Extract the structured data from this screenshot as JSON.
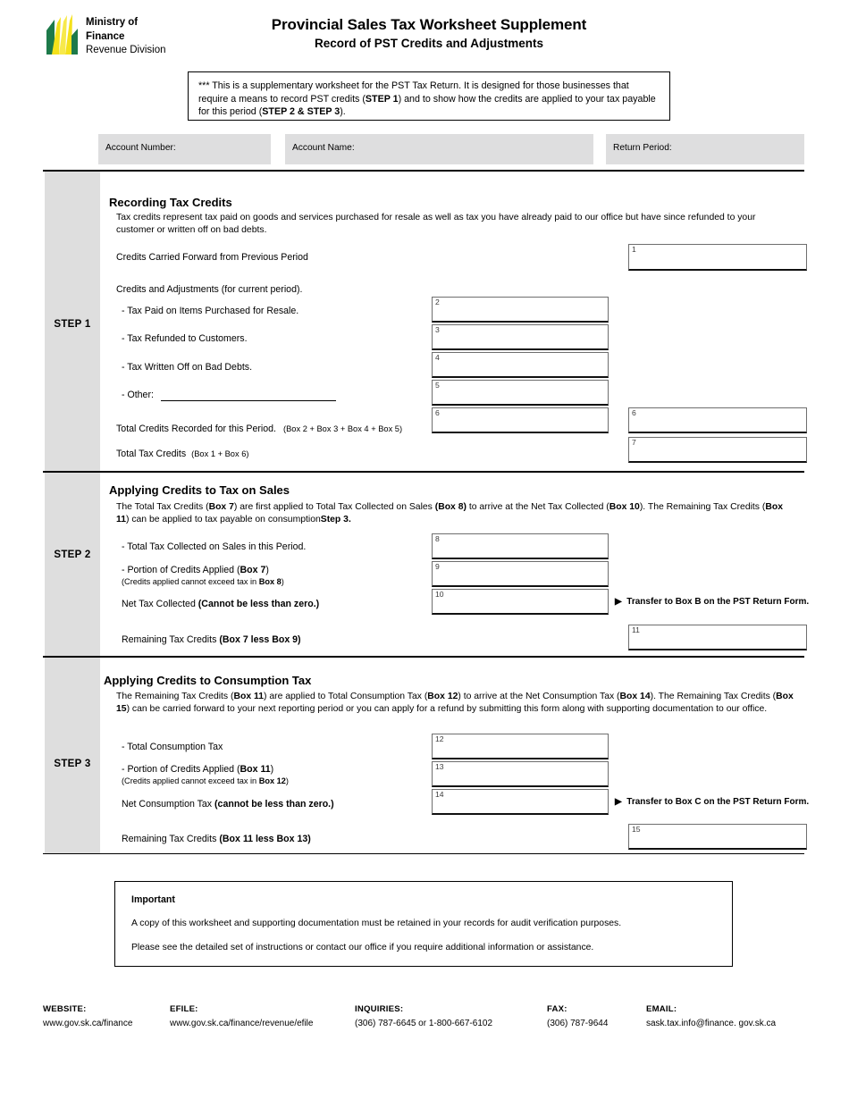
{
  "header": {
    "ministry_line1": "Ministry of",
    "ministry_line2": "Finance",
    "ministry_line3": "Revenue Division",
    "title": "Provincial Sales Tax Worksheet Supplement",
    "subtitle": "Record of PST Credits and Adjustments",
    "logo_icon": "saskatchewan-wheat-sheaf-logo"
  },
  "intro": {
    "text_part1": "*** This is a supplementary worksheet for the PST Tax Return.  It is designed for those businesses that require a means to record PST credits (",
    "bold1": "STEP 1",
    "text_part2": ") and to show how the credits are applied to your tax payable for this period (",
    "bold2": "STEP 2 & STEP 3",
    "text_part3": ")."
  },
  "account": {
    "account_number_label": "Account Number:",
    "account_number_value": "",
    "account_name_label": "Account Name:",
    "account_name_value": "",
    "return_period_label": "Return Period:",
    "return_period_value": ""
  },
  "step1": {
    "step_label": "STEP 1",
    "heading": "Recording Tax Credits",
    "description": "Tax credits represent tax paid on goods and services purchased for resale as well as tax you have already paid to our office but have since refunded to your customer or written off on bad debts.",
    "row_carried_forward": "Credits Carried Forward from Previous Period",
    "row_credits_adjustments": "Credits and Adjustments (for current period).",
    "row_resale": "- Tax Paid on Items Purchased for Resale.",
    "row_refunded": "- Tax Refunded to Customers.",
    "row_bad_debts": "- Tax Written Off on Bad Debts.",
    "row_other": "- Other:",
    "row_total_credits": "Total Credits Recorded for this Period.",
    "row_total_credits_formula": "(Box 2 + Box 3 + Box 4 + Box 5)",
    "row_total_tax_credits": "Total Tax Credits",
    "row_total_tax_credits_formula": "(Box 1 + Box 6)",
    "box1": "1",
    "box2": "2",
    "box3": "3",
    "box4": "4",
    "box5": "5",
    "box6a": "6",
    "box6b": "6",
    "box7": "7"
  },
  "step2": {
    "step_label": "STEP 2",
    "heading": "Applying Credits to Tax on Sales",
    "desc_p1": "The Total Tax Credits (",
    "desc_b1": "Box 7",
    "desc_p2": ") are first applied to Total Tax  Collected on Sales ",
    "desc_b2": "(Box 8)",
    "desc_p3": " to arrive at the Net Tax Collected (",
    "desc_b3": "Box 10",
    "desc_p4": ").  The Remaining Tax Credits (",
    "desc_b4": "Box 11",
    "desc_p5": ") can be applied to tax payable on consumption",
    "desc_b5": "Step 3.",
    "row_total_collected": "- Total Tax Collected on Sales in this Period.",
    "row_portion_applied": "- Portion of Credits Applied (",
    "row_portion_applied_bold": "Box 7",
    "row_portion_applied_end": ")",
    "row_portion_note": "(Credits applied cannot exceed tax in ",
    "row_portion_note_bold": "Box 8",
    "row_portion_note_end": ")",
    "row_net_tax": "Net Tax Collected ",
    "row_net_tax_bold": "(Cannot be less than zero.)",
    "transfer_note": "Transfer to Box B on the PST Return Form.",
    "row_remaining": "Remaining Tax Credits ",
    "row_remaining_bold": "(Box 7 less Box 9)",
    "box8": "8",
    "box9": "9",
    "box10": "10",
    "box11": "11"
  },
  "step3": {
    "step_label": "STEP 3",
    "heading": "Applying Credits to Consumption Tax",
    "desc_p1": "The Remaining Tax Credits (",
    "desc_b1": "Box 11",
    "desc_p2": ") are applied to Total Consumption Tax (",
    "desc_b2": "Box 12",
    "desc_p3": ") to arrive at the Net Consumption Tax (",
    "desc_b3": "Box 14",
    "desc_p4": ").  The Remaining Tax Credits (",
    "desc_b4": "Box 15",
    "desc_p5": ") can be carried forward to your next reporting period or you can apply for a refund by submitting this form along with supporting documentation to our office.",
    "row_total_consumption": "- Total Consumption Tax",
    "row_portion_applied": "- Portion of Credits Applied (",
    "row_portion_applied_bold": "Box 11",
    "row_portion_applied_end": ")",
    "row_portion_note": "(Credits applied cannot exceed tax in ",
    "row_portion_note_bold": "Box 12",
    "row_portion_note_end": ")",
    "row_net_consumption": "Net Consumption Tax ",
    "row_net_consumption_bold": "(cannot be less than zero.)",
    "transfer_note": "Transfer to Box C on the PST Return Form.",
    "row_remaining": "Remaining Tax Credits ",
    "row_remaining_bold": "(Box 11 less Box 13)",
    "box12": "12",
    "box13": "13",
    "box14": "14",
    "box15": "15"
  },
  "important": {
    "title": "Important",
    "line1": "A copy of this worksheet and supporting documentation must be retained in your records for audit verification purposes.",
    "line2": "Please see the detailed set of instructions or contact our office if you require additional information or assistance."
  },
  "footer": {
    "website_label": "WEBSITE:",
    "website_value": "www.gov.sk.ca/finance",
    "efile_label": "EFILE:",
    "efile_value": "www.gov.sk.ca/finance/revenue/efile",
    "inquiries_label": "INQUIRIES:",
    "inquiries_value": "(306) 787-6645 or 1-800-667-6102",
    "fax_label": "FAX:",
    "fax_value": "(306) 787-9644",
    "email_label": "EMAIL:",
    "email_value": "sask.tax.info@finance. gov.sk.ca"
  },
  "colors": {
    "logo_green": "#1d7a4a",
    "logo_yellow": "#f4e11a",
    "gray_field": "#dededf",
    "gray_step": "#dedede"
  }
}
